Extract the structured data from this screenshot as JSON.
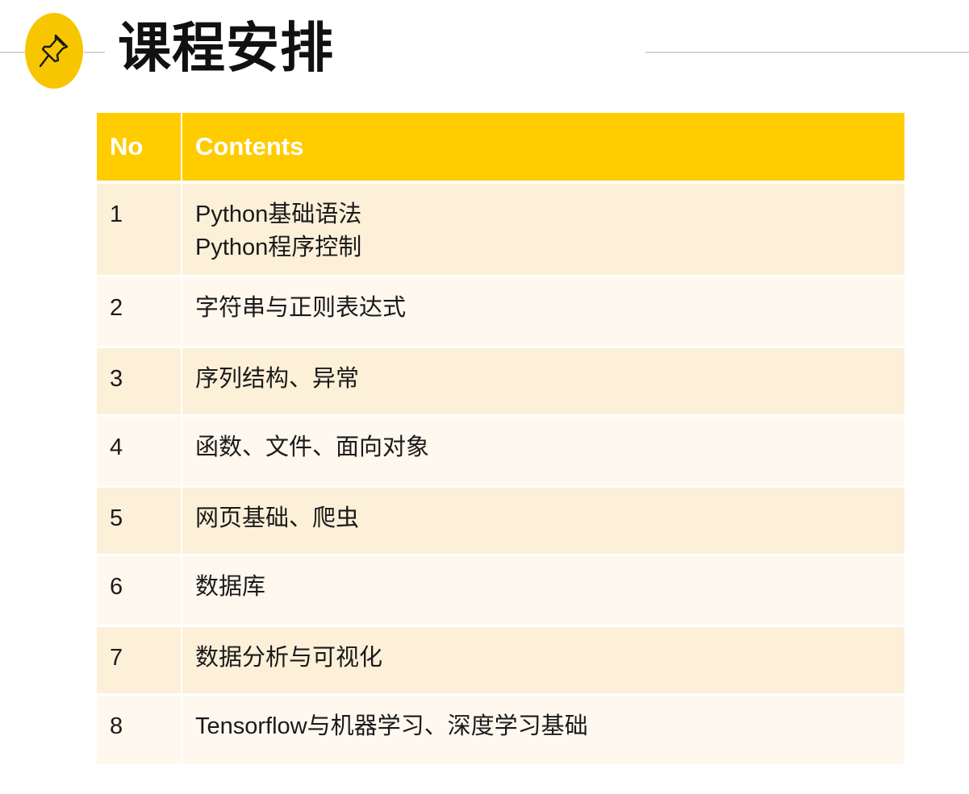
{
  "slide": {
    "title": "课程安排",
    "pin_icon": "pushpin-icon",
    "accent_color": "#ffcc00"
  },
  "table": {
    "headers": {
      "no": "No",
      "contents": "Contents"
    },
    "rows": [
      {
        "no": "1",
        "contents": [
          "Python基础语法",
          "Python程序控制"
        ]
      },
      {
        "no": "2",
        "contents": [
          "字符串与正则表达式"
        ]
      },
      {
        "no": "3",
        "contents": [
          "序列结构、异常"
        ]
      },
      {
        "no": "4",
        "contents": [
          "函数、文件、面向对象"
        ]
      },
      {
        "no": "5",
        "contents": [
          "网页基础、爬虫"
        ]
      },
      {
        "no": "6",
        "contents": [
          "数据库"
        ]
      },
      {
        "no": "7",
        "contents": [
          "数据分析与可视化"
        ]
      },
      {
        "no": "8",
        "contents": [
          "Tensorflow与机器学习、深度学习基础"
        ]
      }
    ]
  }
}
